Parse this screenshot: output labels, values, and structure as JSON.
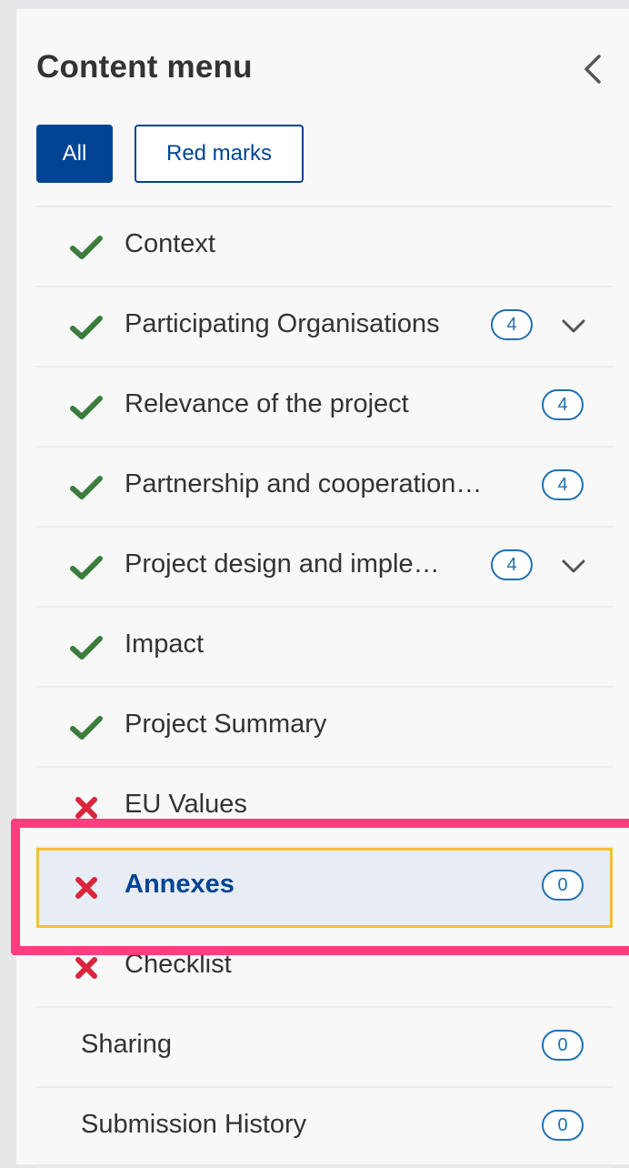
{
  "header": {
    "title": "Content menu",
    "collapse_icon": "chevron-left-icon"
  },
  "filters": {
    "all_label": "All",
    "red_marks_label": "Red marks",
    "active": "All"
  },
  "colors": {
    "primary": "#004494",
    "check": "#3a7d3c",
    "cross": "#d7263d",
    "badge": "#1f6fb2",
    "active_outline": "#f2c037",
    "annotation": "#ff3d7f"
  },
  "menu": {
    "items": [
      {
        "label": "Context",
        "status": "check"
      },
      {
        "label": "Participating Organisations",
        "status": "check",
        "badge": "4",
        "expandable": true
      },
      {
        "label": "Relevance of the project",
        "status": "check",
        "badge": "4"
      },
      {
        "label": "Partnership and cooperation…",
        "status": "check",
        "badge": "4"
      },
      {
        "label": "Project design and imple…",
        "status": "check",
        "badge": "4",
        "expandable": true
      },
      {
        "label": "Impact",
        "status": "check"
      },
      {
        "label": "Project Summary",
        "status": "check"
      },
      {
        "label": "EU Values",
        "status": "cross"
      },
      {
        "label": "Annexes",
        "status": "cross",
        "badge": "0",
        "active": true
      },
      {
        "label": "Checklist",
        "status": "cross"
      },
      {
        "label": "Sharing",
        "status": "none",
        "badge": "0"
      },
      {
        "label": "Submission History",
        "status": "none",
        "badge": "0"
      }
    ]
  }
}
